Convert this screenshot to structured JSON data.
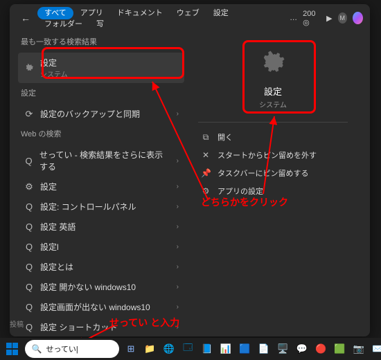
{
  "topbar": {
    "tabs": [
      "すべて",
      "アプリ",
      "ドキュメント",
      "ウェブ",
      "設定",
      "フォルダー",
      "写"
    ],
    "active_index": 0,
    "points": "200",
    "points_icon": "◎"
  },
  "left": {
    "best_match_header": "最も一致する検索結果",
    "best_match": {
      "title": "設定",
      "subtitle": "システム"
    },
    "group_settings": "設定",
    "items_settings": [
      {
        "icon": "⟳",
        "label": "設定のバックアップと同期"
      }
    ],
    "group_web": "Web の検索",
    "items_web": [
      {
        "icon": "Q",
        "label": "せってい - 検索結果をさらに表示する"
      },
      {
        "icon": "⚙",
        "label": "設定"
      },
      {
        "icon": "Q",
        "label": "設定: コントロールパネル"
      },
      {
        "icon": "Q",
        "label": "設定 英語"
      },
      {
        "icon": "Q",
        "label": "設定l"
      },
      {
        "icon": "Q",
        "label": "設定とは"
      },
      {
        "icon": "Q",
        "label": "設定 開かない windows10"
      },
      {
        "icon": "Q",
        "label": "設定画面が出ない windows10"
      },
      {
        "icon": "Q",
        "label": "設定 ショートカット"
      }
    ]
  },
  "right": {
    "title": "設定",
    "subtitle": "システム",
    "actions": [
      {
        "icon": "⧉",
        "label": "開く"
      },
      {
        "icon": "✕",
        "label": "スタートからピン留めを外す"
      },
      {
        "icon": "📌",
        "label": "タスクバーにピン留めする"
      },
      {
        "icon": "⚙",
        "label": "アプリの設定"
      }
    ]
  },
  "annotations": {
    "click_either": "どちらかをクリック",
    "type_hint": "せってい  と入力"
  },
  "taskbar": {
    "search_value": "せってい|",
    "label": "投稿"
  }
}
